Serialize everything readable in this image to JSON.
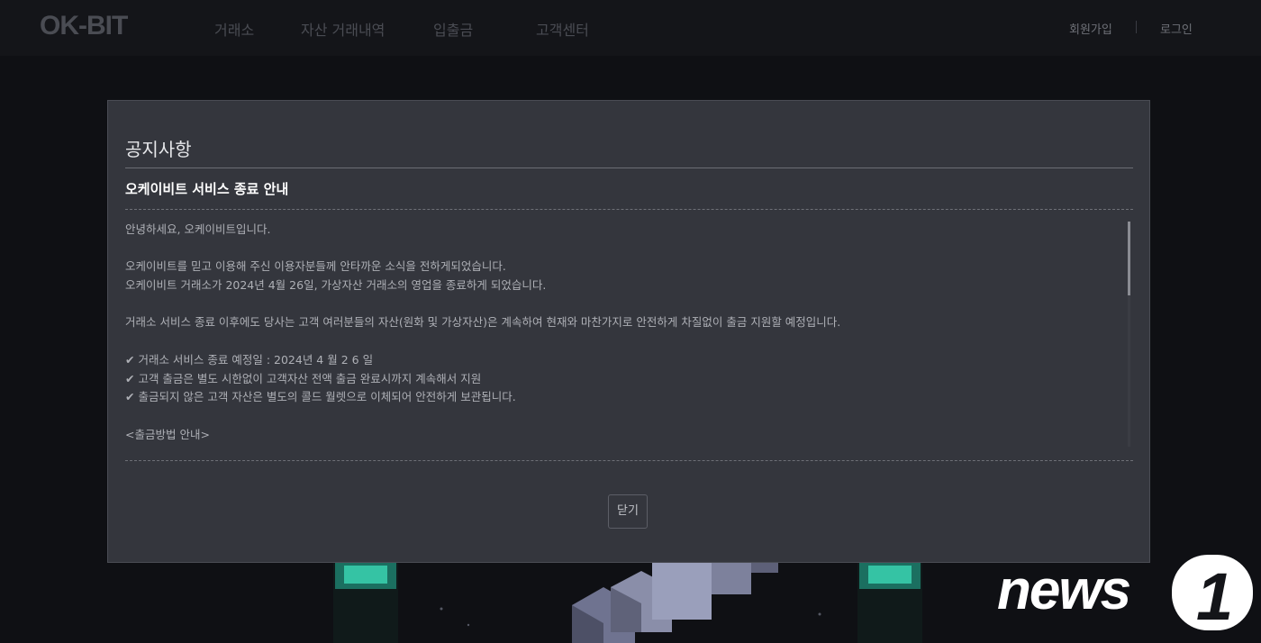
{
  "header": {
    "logo": "OK-BIT",
    "nav": [
      "거래소",
      "자산 거래내역",
      "입출금",
      "고객센터"
    ],
    "signup": "회원가입",
    "login": "로그인"
  },
  "modal": {
    "title": "공지사항",
    "heading": "오케이비트 서비스 종료 안내",
    "body": [
      "안녕하세요, 오케이비트입니다.",
      "",
      "오케이비트를 믿고 이용해 주신 이용자분들께 안타까운 소식을 전하게되었습니다.",
      "오케이비트 거래소가 2024년 4월 26일, 가상자산 거래소의 영업을 종료하게 되었습니다.",
      "",
      "거래소 서비스 종료 이후에도 당사는 고객 여러분들의 자산(원화 및 가상자산)은 계속하여 현재와 마찬가지로 안전하게 차질없이 출금 지원할 예정입니다.",
      "",
      "✔ 거래소 서비스 종료 예정일 : 2024년 4 월 2 6 일",
      "✔ 고객 출금은 별도 시한없이 고객자산 전액 출금 완료시까지 계속해서 지원",
      "✔ 출금되지 않은 고객 자산은 별도의 콜드 월렛으로 이체되어 안전하게 보관됩니다.",
      "",
      "<출금방법 안내>"
    ],
    "close_label": "닫기"
  },
  "watermark": {
    "text": "news",
    "number": "1"
  },
  "colors": {
    "page_background": "#0f1014",
    "modal_background": "#34363d",
    "accent_teal": "#2e9f86"
  }
}
